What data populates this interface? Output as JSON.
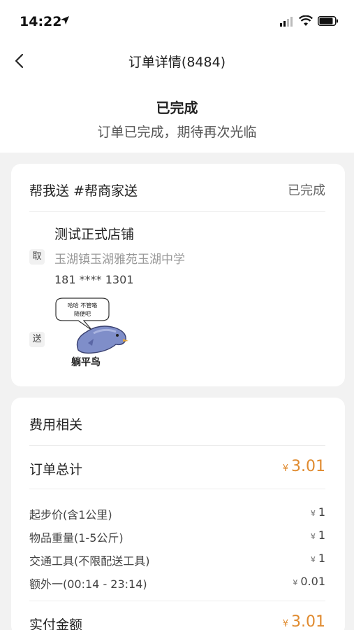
{
  "status_bar": {
    "time": "14:22"
  },
  "nav": {
    "title": "订单详情(8484)"
  },
  "status": {
    "title": "已完成",
    "subtitle": "订单已完成，期待再次光临"
  },
  "order": {
    "type": "帮我送 #帮商家送",
    "state": "已完成",
    "pickup_tag": "取",
    "shop_name": "测试正式店铺",
    "address": "玉湖镇玉湖雅苑玉湖中学",
    "phone": "181 **** 1301",
    "deliver_tag": "送",
    "sticker": {
      "line1": "哈哈 不管咯",
      "line2": "随便吧",
      "caption": "躺平鸟"
    }
  },
  "fees": {
    "title": "费用相关",
    "currency": "¥",
    "total_label": "订单总计",
    "total_value": "3.01",
    "items": [
      {
        "label": "起步价(含1公里)",
        "value": "1"
      },
      {
        "label": "物品重量(1-5公斤)",
        "value": "1"
      },
      {
        "label": "交通工具(不限配送工具)",
        "value": "1"
      },
      {
        "label": "额外一(00:14 - 23:14)",
        "value": "0.01"
      }
    ],
    "paid_label": "实付金额",
    "paid_value": "3.01"
  },
  "colors": {
    "accent": "#e08a2e",
    "background": "#f2f2f2"
  }
}
